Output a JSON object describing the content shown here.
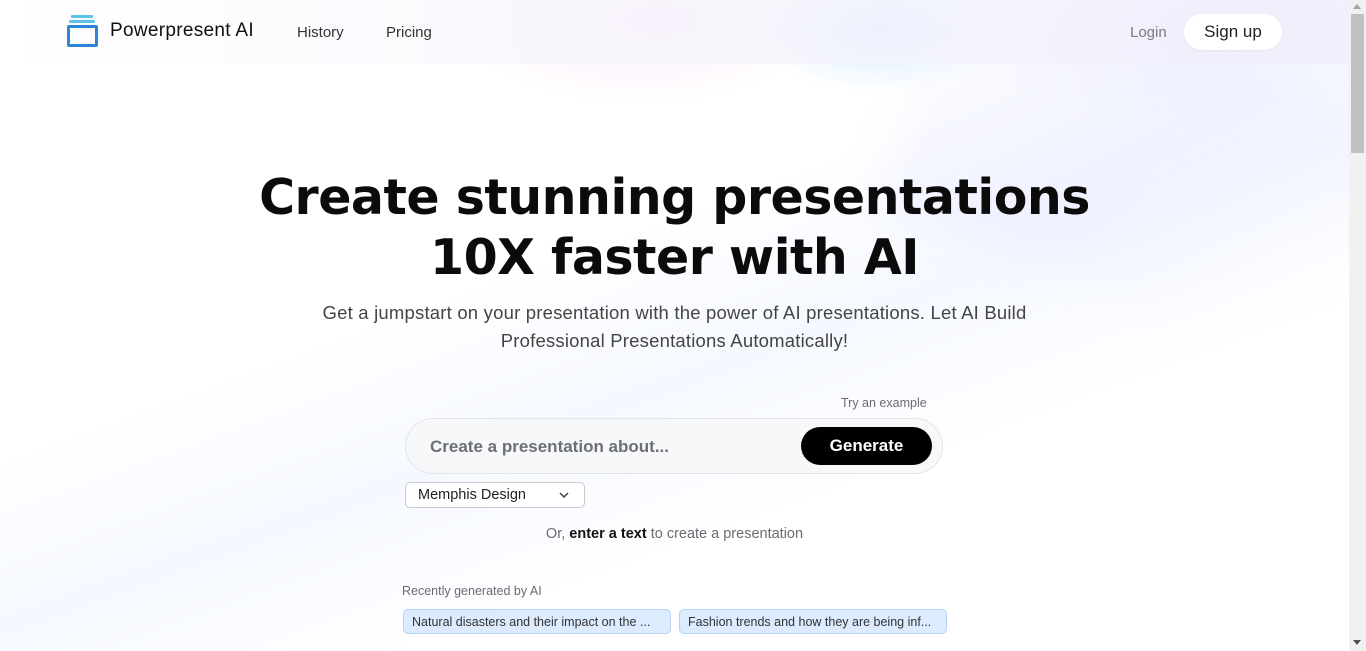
{
  "header": {
    "brand": "Powerpresent AI",
    "logo_icon": "stacked-slides-icon",
    "nav": [
      {
        "label": "History"
      },
      {
        "label": "Pricing"
      }
    ],
    "login_label": "Login",
    "signup_label": "Sign up"
  },
  "hero": {
    "title_line1": "Create stunning presentations",
    "title_line2": "10X faster with AI",
    "subtitle_line1": "Get a jumpstart on your presentation with the power of AI presentations. Let AI Build",
    "subtitle_line2": "Professional Presentations Automatically!"
  },
  "prompt": {
    "try_example_label": "Try an example",
    "placeholder": "Create a presentation about...",
    "value": "",
    "generate_label": "Generate"
  },
  "theme_select": {
    "selected": "Memphis Design",
    "icon": "chevron-down-icon"
  },
  "alt_option": {
    "prefix": "Or,",
    "link": "enter a text",
    "suffix": "to create a presentation"
  },
  "recent": {
    "label": "Recently generated by AI",
    "items": [
      {
        "label": "Natural disasters and their impact on the ..."
      },
      {
        "label": "Fashion trends and how they are being inf..."
      }
    ]
  },
  "colors": {
    "logo_light": "#5cc3ea",
    "logo_dark": "#2b86d8",
    "chip_bg": "#dcebfd",
    "generate_bg": "#000000"
  }
}
